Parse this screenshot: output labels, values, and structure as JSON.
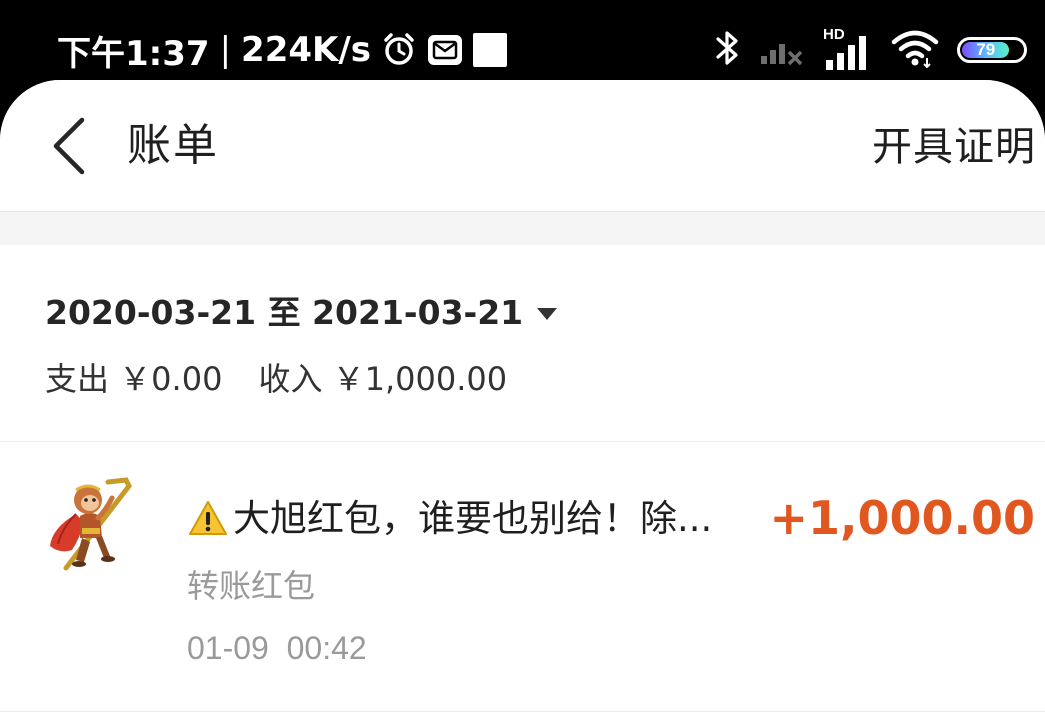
{
  "status_bar": {
    "time": "下午1:37",
    "separator": "|",
    "speed": "224K/s",
    "network_label": "HD",
    "battery": "79",
    "icons": [
      "alarm-icon",
      "mail-icon",
      "notification-square-icon",
      "bluetooth-icon",
      "signal-weak-icon",
      "signal-hd-icon",
      "wifi-icon",
      "battery-icon"
    ]
  },
  "nav": {
    "title": "账单",
    "action": "开具证明",
    "back_icon": "chevron-left-icon"
  },
  "summary": {
    "date_range": "2020-03-21 至 2021-03-21",
    "expense": "支出 ￥0.00",
    "income": "收入 ￥1,000.00"
  },
  "transaction": {
    "icon": "warning-icon",
    "title": "大旭红包，谁要也别给！除...",
    "amount": "+1,000.00",
    "type": "转账红包",
    "time": "01-09  00:42",
    "amount_color": "#e0581f"
  },
  "colors": {
    "accent": "#e0581f",
    "muted": "#9a9a9a",
    "background": "#f5f5f5"
  }
}
